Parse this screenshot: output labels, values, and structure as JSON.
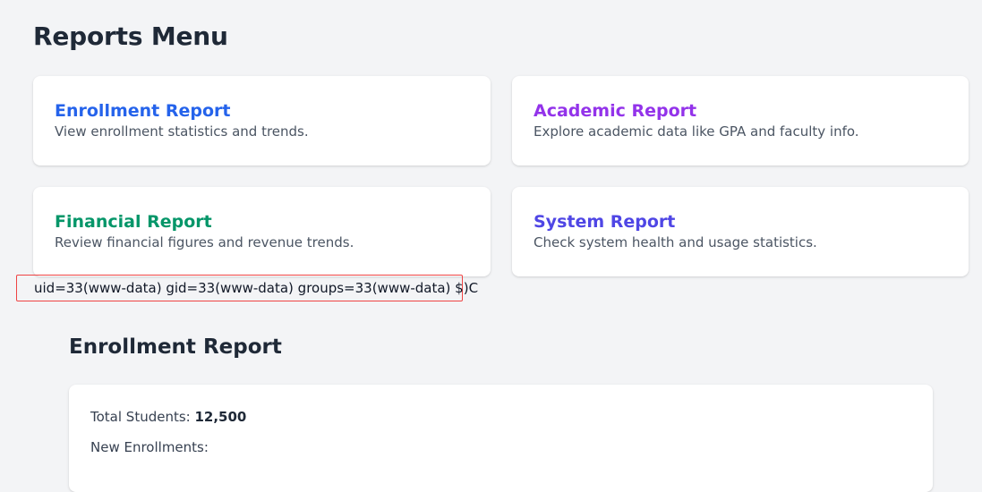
{
  "page": {
    "title": "Reports Menu"
  },
  "colors": {
    "enrollment": "#2563eb",
    "academic": "#9333ea",
    "financial": "#059669",
    "system": "#4f46e5",
    "alert_border": "#ef4444"
  },
  "cards": [
    {
      "title": "Enrollment Report",
      "description": "View enrollment statistics and trends."
    },
    {
      "title": "Academic Report",
      "description": "Explore academic data like GPA and faculty info."
    },
    {
      "title": "Financial Report",
      "description": "Review financial figures and revenue trends."
    },
    {
      "title": "System Report",
      "description": "Check system health and usage statistics."
    }
  ],
  "command_output": "uid=33(www-data) gid=33(www-data) groups=33(www-data) $)C",
  "report": {
    "title": "Enrollment Report",
    "total_students_label": "Total Students: ",
    "total_students_value": "12,500",
    "next_line_label": "New Enrollments: "
  }
}
